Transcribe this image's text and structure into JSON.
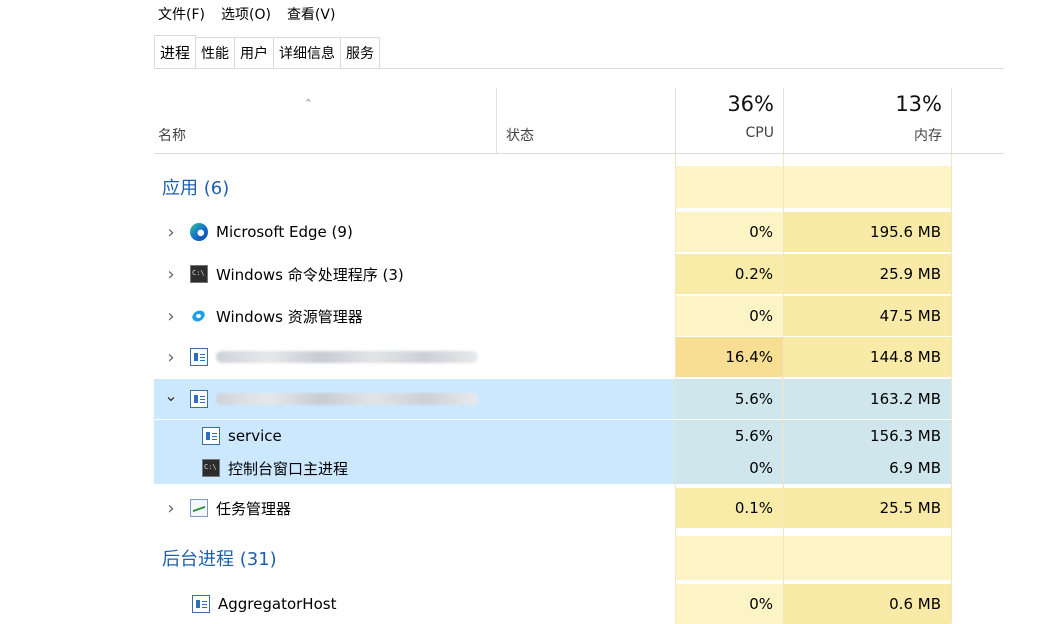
{
  "menu": [
    "文件(F)",
    "选项(O)",
    "查看(V)"
  ],
  "tabs": [
    "进程",
    "性能",
    "用户",
    "详细信息",
    "服务"
  ],
  "active_tab": "进程",
  "headers": {
    "sort_indicator": "^",
    "name": "名称",
    "status": "状态",
    "cpu_percent": "36%",
    "cpu": "CPU",
    "mem_percent": "13%",
    "mem": "内存"
  },
  "groups": {
    "apps": "应用 (6)",
    "background": "后台进程 (31)"
  },
  "rows": [
    {
      "kind": "group",
      "label_ref": "apps"
    },
    {
      "kind": "app",
      "icon": "edge-icon",
      "name": "Microsoft Edge (9)",
      "cpu": "0%",
      "mem": "195.6 MB",
      "expanded": false
    },
    {
      "kind": "app",
      "icon": "console-icon",
      "name": "Windows 命令处理程序 (3)",
      "cpu": "0.2%",
      "mem": "25.9 MB",
      "expanded": false
    },
    {
      "kind": "app",
      "icon": "explorer-icon",
      "name": "Windows 资源管理器",
      "cpu": "0%",
      "mem": "47.5 MB",
      "expanded": false
    },
    {
      "kind": "app",
      "icon": "service-icon",
      "name": "",
      "blurred": true,
      "cpu": "16.4%",
      "mem": "144.8 MB",
      "expanded": false
    },
    {
      "kind": "app",
      "icon": "service-icon",
      "name": "",
      "blurred": true,
      "cpu": "5.6%",
      "mem": "163.2 MB",
      "expanded": true,
      "selected": true
    },
    {
      "kind": "child",
      "icon": "service-icon",
      "name": "service",
      "cpu": "5.6%",
      "mem": "156.3 MB",
      "selected": true
    },
    {
      "kind": "child",
      "icon": "console-icon",
      "name": "控制台窗口主进程",
      "cpu": "0%",
      "mem": "6.9 MB",
      "selected": true
    },
    {
      "kind": "app",
      "icon": "task-manager-icon",
      "name": "任务管理器",
      "cpu": "0.1%",
      "mem": "25.5 MB",
      "expanded": false
    },
    {
      "kind": "group",
      "label_ref": "background"
    },
    {
      "kind": "child-bg",
      "icon": "service-icon",
      "name": "AggregatorHost",
      "cpu": "0%",
      "mem": "0.6 MB"
    }
  ],
  "colors": {
    "cpu_light": "#fdf4c5",
    "cpu_medium": "#f9eca8",
    "cpu_high": "#f8de92",
    "mem_light": "#fdf4c5",
    "mem_medium": "#faeaa7",
    "selected": "#cce8ff",
    "group_text": "#1f5fb0"
  }
}
